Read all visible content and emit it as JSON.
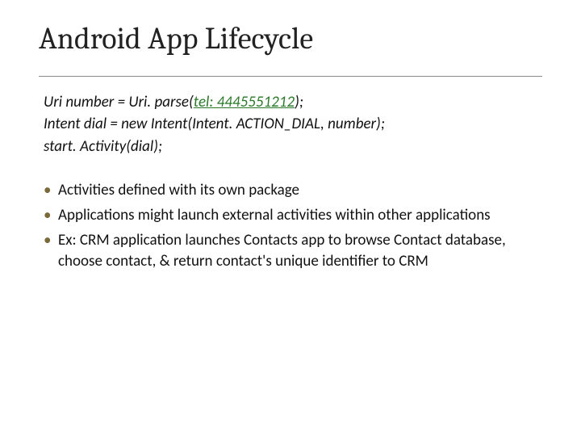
{
  "title": "Android App Lifecycle",
  "code": {
    "lines": [
      {
        "pre": "Uri number = Uri. parse(",
        "link": "tel: 4445551212",
        "post": ");"
      },
      {
        "pre": "Intent dial = new Intent(Intent. ACTION_DIAL, number);",
        "link": "",
        "post": ""
      },
      {
        "pre": "start. Activity(dial);",
        "link": "",
        "post": ""
      }
    ]
  },
  "bullets": [
    "Activities defined with its own package",
    "Applications might launch external activities within other applications",
    "Ex:  CRM application launches Contacts app to browse Contact database, choose contact, & return contact's unique identifier to CRM"
  ]
}
